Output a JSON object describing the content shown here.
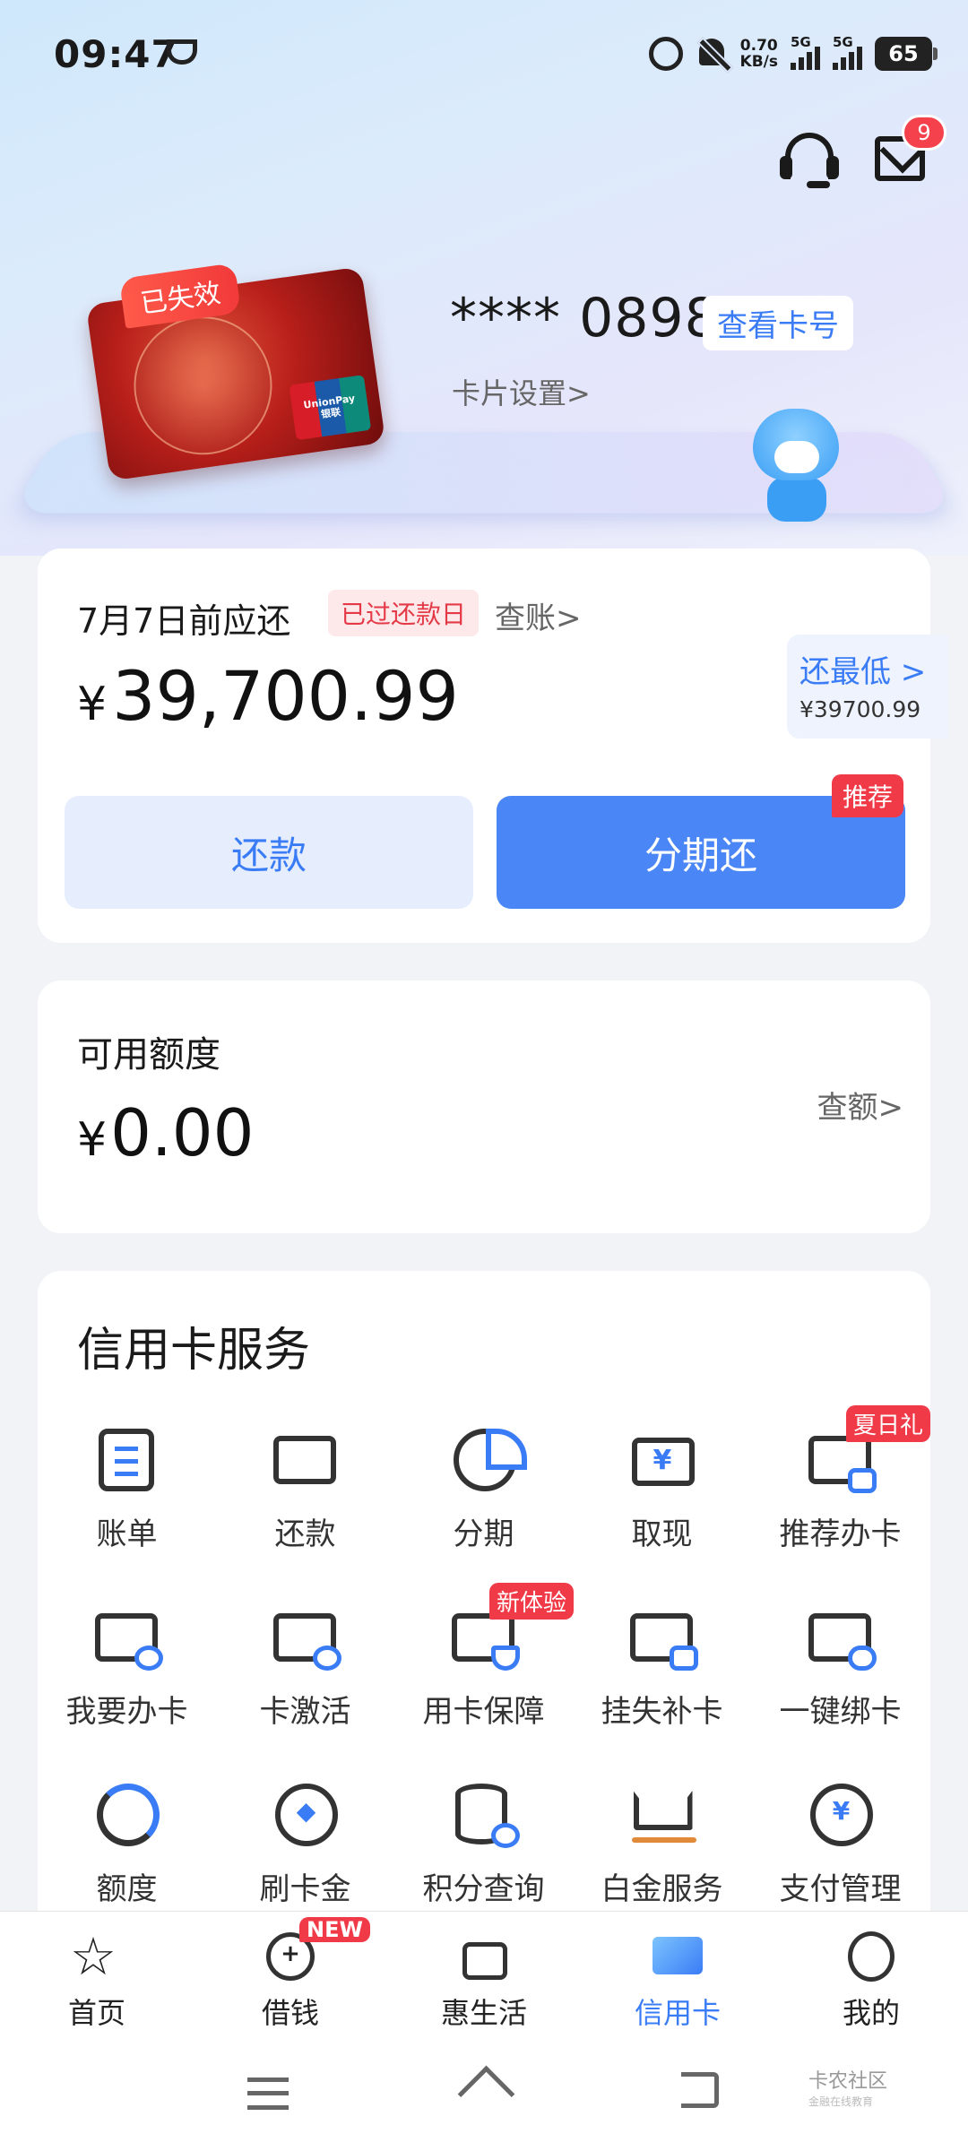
{
  "status_bar": {
    "time": "09:47",
    "net_speed_value": "0.70",
    "net_speed_unit": "KB/s",
    "sim1": "5G",
    "sim2": "5G",
    "battery": "65"
  },
  "header": {
    "mail_badge_count": "9"
  },
  "card": {
    "status_tag": "已失效",
    "masked_number": "**** 0898",
    "view_number_label": "查看卡号",
    "settings_label": "卡片设置>",
    "unionpay_text_1": "UnionPay",
    "unionpay_text_2": "银联"
  },
  "repayment": {
    "due_label": "7月7日前应还",
    "overdue_tag": "已过还款日",
    "view_bill_label": "查账>",
    "currency": "¥",
    "amount": "39,700.99",
    "min_pay_label": "还最低 >",
    "min_pay_amount": "¥39700.99",
    "repay_button": "还款",
    "installment_button": "分期还",
    "recommend_tag": "推荐"
  },
  "limit": {
    "label": "可用额度",
    "currency": "¥",
    "amount": "0.00",
    "check_label": "查额>"
  },
  "services": {
    "title": "信用卡服务",
    "items": [
      {
        "label": "账单",
        "icon": "bill-icon"
      },
      {
        "label": "还款",
        "icon": "repay-icon"
      },
      {
        "label": "分期",
        "icon": "installment-pie-icon"
      },
      {
        "label": "取现",
        "icon": "cash-withdraw-icon"
      },
      {
        "label": "推荐办卡",
        "icon": "recommend-card-icon",
        "tag": "夏日礼"
      },
      {
        "label": "我要办卡",
        "icon": "apply-card-icon"
      },
      {
        "label": "卡激活",
        "icon": "activate-card-icon"
      },
      {
        "label": "用卡保障",
        "icon": "card-protection-icon",
        "tag": "新体验"
      },
      {
        "label": "挂失补卡",
        "icon": "report-loss-icon"
      },
      {
        "label": "一键绑卡",
        "icon": "bind-card-icon"
      },
      {
        "label": "额度",
        "icon": "limit-ring-icon"
      },
      {
        "label": "刷卡金",
        "icon": "swipe-reward-icon"
      },
      {
        "label": "积分查询",
        "icon": "points-query-icon"
      },
      {
        "label": "白金服务",
        "icon": "platinum-crown-icon"
      },
      {
        "label": "支付管理",
        "icon": "payment-manage-icon"
      }
    ]
  },
  "bottom_nav": {
    "items": [
      {
        "label": "首页",
        "icon": "star-icon"
      },
      {
        "label": "借钱",
        "icon": "borrow-icon",
        "badge": "NEW"
      },
      {
        "label": "惠生活",
        "icon": "gift-icon"
      },
      {
        "label": "信用卡",
        "icon": "credit-card-icon",
        "active": true
      },
      {
        "label": "我的",
        "icon": "profile-icon"
      }
    ]
  },
  "watermark": {
    "main": "卡农社区",
    "sub": "金融在线教育"
  },
  "colors": {
    "accent": "#3a7cf5",
    "alert": "#f13a48"
  }
}
